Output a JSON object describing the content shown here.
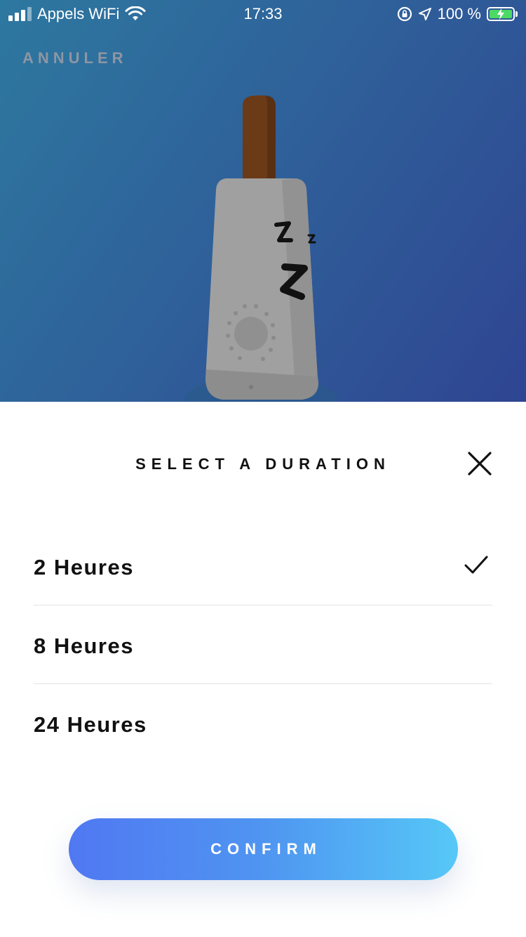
{
  "status_bar": {
    "carrier": "Appels WiFi",
    "time": "17:33",
    "battery": "100 %",
    "icons": [
      "signal-icon",
      "wifi-icon",
      "orientation-lock-icon",
      "location-icon",
      "battery-charging-icon"
    ]
  },
  "header": {
    "cancel_label": "ANNULER"
  },
  "illustration": {
    "sleep_text": [
      "Z",
      "z",
      "Z"
    ]
  },
  "sheet": {
    "title": "SELECT A DURATION",
    "options": [
      {
        "label": "2 Heures",
        "selected": true
      },
      {
        "label": "8 Heures",
        "selected": false
      },
      {
        "label": "24 Heures",
        "selected": false
      }
    ],
    "confirm_label": "CONFIRM"
  },
  "colors": {
    "hero_gradient": [
      "#2d78a0",
      "#2f4592"
    ],
    "confirm_gradient": [
      "#5078f2",
      "#56c8f7"
    ],
    "device_body": "#9e9e9e",
    "device_stick": "#6b3a17"
  }
}
